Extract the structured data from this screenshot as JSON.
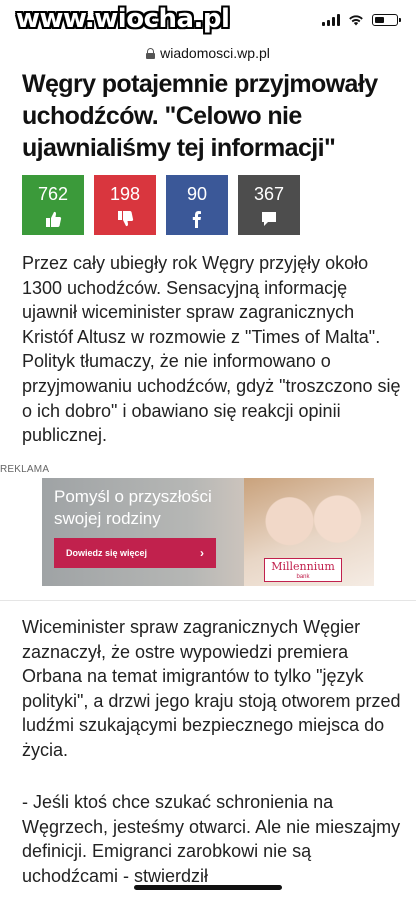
{
  "watermark": "www.wiocha.pl",
  "browser": {
    "url": "wiadomosci.wp.pl"
  },
  "article": {
    "headline": "Węgry potajemnie przyjmowały uchodźców. \"Celowo nie ujawnialiśmy tej informacji\"",
    "reactions": {
      "like": {
        "count": "762",
        "icon": "thumbs-up-icon",
        "color": "#3b9a3a"
      },
      "dislike": {
        "count": "198",
        "icon": "thumbs-down-icon",
        "color": "#d9363e"
      },
      "facebook": {
        "count": "90",
        "icon": "facebook-icon",
        "color": "#3b5898"
      },
      "comments": {
        "count": "367",
        "icon": "comment-icon",
        "color": "#4d4d4d"
      }
    },
    "paragraph1": "Przez cały ubiegły rok Węgry przyjęły około 1300 uchodźców. Sensacyjną informację ujawnił wiceminister spraw zagranicznych Kristóf Altusz w rozmowie z \"Times of Malta\". Polityk tłumaczy, że nie informowano o przyjmowaniu uchodźców, gdyż \"troszczono się o ich dobro\" i obawiano się reakcji opinii publicznej.",
    "paragraph2": "Wiceminister spraw zagranicznych Węgier zaznaczył, że ostre wypowiedzi premiera Orbana na temat imigrantów to tylko \"język polityki\", a drzwi jego kraju stoją otworem przed ludźmi szukającymi bezpiecznego miejsca do życia.",
    "paragraph3": "- Jeśli ktoś chce szukać schronienia na Węgrzech, jesteśmy otwarci. Ale nie mieszajmy definicji. Emigranci zarobkowi nie są uchodźcami - stwierdził"
  },
  "ad": {
    "label": "REKLAMA",
    "title": "Pomyśl o przyszłości swojej rodziny",
    "button": "Dowiedz się więcej",
    "logo_name": "Millennium",
    "logo_sub": "bank",
    "accent": "#c1214d"
  }
}
